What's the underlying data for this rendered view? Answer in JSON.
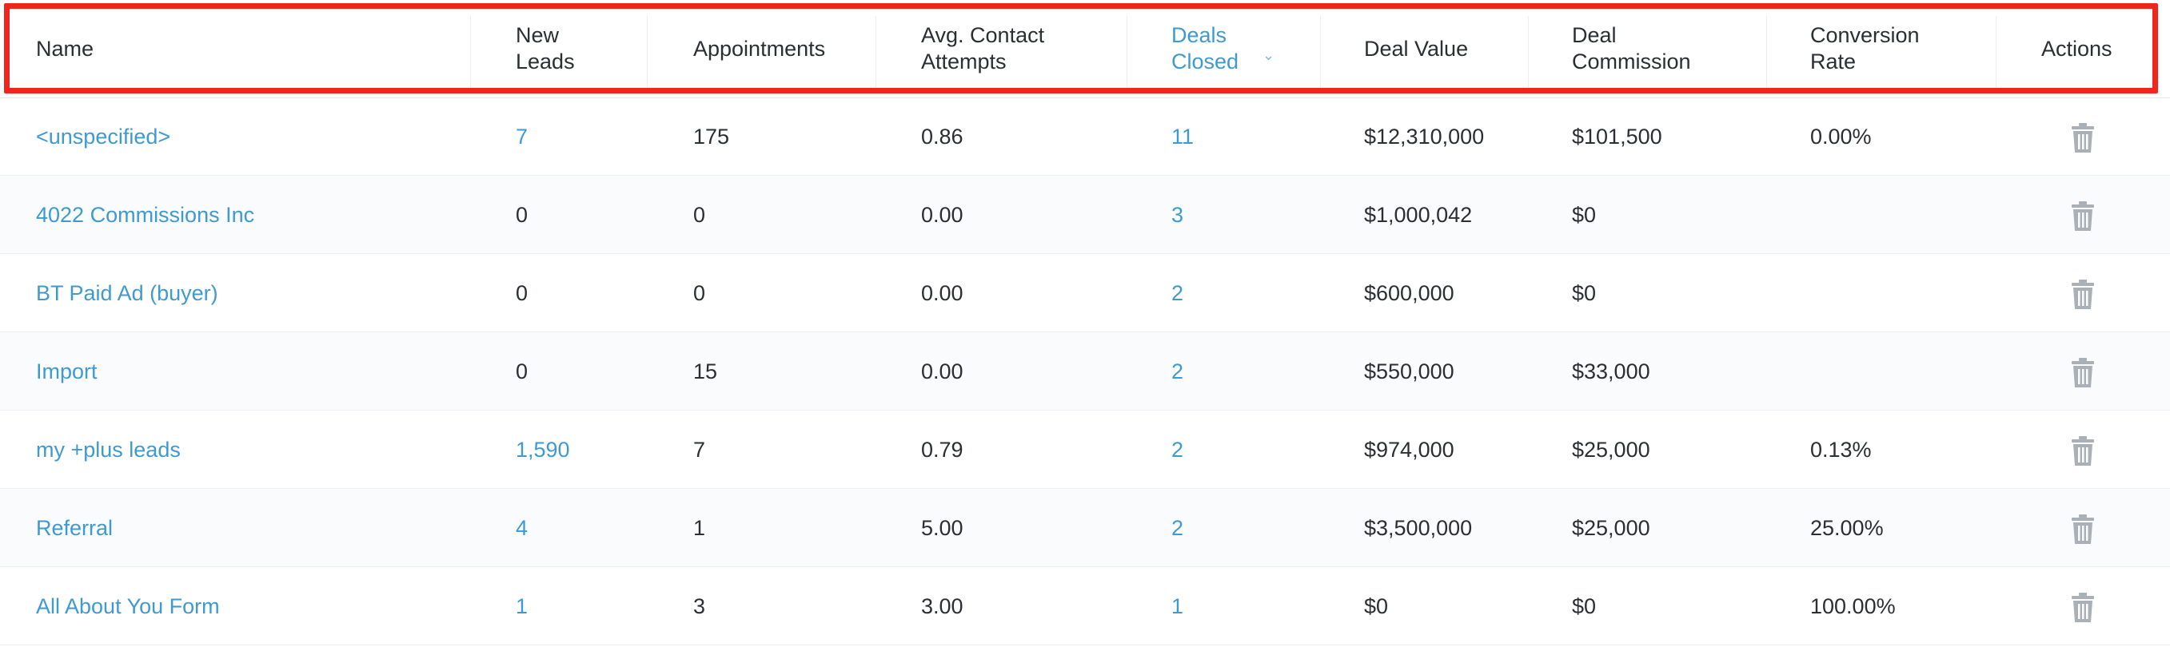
{
  "table": {
    "headers": {
      "name": "Name",
      "new_leads": "New Leads",
      "appointments": "Appointments",
      "avg_contact_attempts": "Avg. Contact Attempts",
      "deals_closed": "Deals Closed",
      "deal_value": "Deal Value",
      "deal_commission": "Deal Commission",
      "conversion_rate": "Conversion Rate",
      "actions": "Actions"
    },
    "sort": {
      "column": "deals_closed",
      "direction": "descending",
      "icon": "chevron-down-icon"
    },
    "rows": [
      {
        "name": "<unspecified>",
        "new_leads": "7",
        "appointments": "175",
        "avg_contact_attempts": "0.86",
        "deals_closed": "11",
        "deal_value": "$12,310,000",
        "deal_commission": "$101,500",
        "conversion_rate": "0.00%"
      },
      {
        "name": "4022 Commissions Inc",
        "new_leads": "0",
        "appointments": "0",
        "avg_contact_attempts": "0.00",
        "deals_closed": "3",
        "deal_value": "$1,000,042",
        "deal_commission": "$0",
        "conversion_rate": ""
      },
      {
        "name": "BT Paid Ad (buyer)",
        "new_leads": "0",
        "appointments": "0",
        "avg_contact_attempts": "0.00",
        "deals_closed": "2",
        "deal_value": "$600,000",
        "deal_commission": "$0",
        "conversion_rate": ""
      },
      {
        "name": "Import",
        "new_leads": "0",
        "appointments": "15",
        "avg_contact_attempts": "0.00",
        "deals_closed": "2",
        "deal_value": "$550,000",
        "deal_commission": "$33,000",
        "conversion_rate": ""
      },
      {
        "name": "my +plus leads",
        "new_leads": "1,590",
        "appointments": "7",
        "avg_contact_attempts": "0.79",
        "deals_closed": "2",
        "deal_value": "$974,000",
        "deal_commission": "$25,000",
        "conversion_rate": "0.13%"
      },
      {
        "name": "Referral",
        "new_leads": "4",
        "appointments": "1",
        "avg_contact_attempts": "5.00",
        "deals_closed": "2",
        "deal_value": "$3,500,000",
        "deal_commission": "$25,000",
        "conversion_rate": "25.00%"
      },
      {
        "name": "All About You Form",
        "new_leads": "1",
        "appointments": "3",
        "avg_contact_attempts": "3.00",
        "deals_closed": "1",
        "deal_value": "$0",
        "deal_commission": "$0",
        "conversion_rate": "100.00%"
      }
    ],
    "row_action_icon": "trash-icon"
  },
  "colors": {
    "link": "#3e9ad1",
    "text": "#2b2f33",
    "icon": "#a9b0b8",
    "highlight_border": "#f0261c",
    "row_alt_bg": "#fafbfc"
  }
}
